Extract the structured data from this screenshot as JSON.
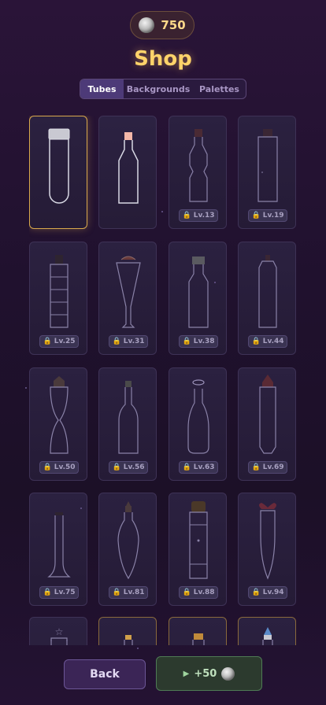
{
  "header": {
    "coin_balance": "750",
    "title": "Shop"
  },
  "tabs": [
    {
      "label": "Tubes",
      "active": true
    },
    {
      "label": "Backgrounds",
      "active": false
    },
    {
      "label": "Palettes",
      "active": false
    }
  ],
  "items": [
    {
      "shape": "test-tube",
      "state": "selected",
      "lock": ""
    },
    {
      "shape": "bottle-pink-cap",
      "state": "owned",
      "lock": ""
    },
    {
      "shape": "wavy-bottle",
      "state": "locked",
      "lock": "Lv.13"
    },
    {
      "shape": "tall-cylinder",
      "state": "locked",
      "lock": "Lv.19"
    },
    {
      "shape": "ladder-tube",
      "state": "locked",
      "lock": "Lv.25"
    },
    {
      "shape": "funnel-glass",
      "state": "locked",
      "lock": "Lv.31"
    },
    {
      "shape": "flask-cap",
      "state": "locked",
      "lock": "Lv.38"
    },
    {
      "shape": "rounded-jar",
      "state": "locked",
      "lock": "Lv.44"
    },
    {
      "shape": "hourglass",
      "state": "locked",
      "lock": "Lv.50"
    },
    {
      "shape": "wine-bottle",
      "state": "locked",
      "lock": "Lv.56"
    },
    {
      "shape": "halo-flask",
      "state": "locked",
      "lock": "Lv.63"
    },
    {
      "shape": "potion-house",
      "state": "locked",
      "lock": "Lv.69"
    },
    {
      "shape": "bell-column",
      "state": "locked",
      "lock": "Lv.75"
    },
    {
      "shape": "vase",
      "state": "locked",
      "lock": "Lv.81"
    },
    {
      "shape": "cork-column",
      "state": "locked",
      "lock": "Lv.88"
    },
    {
      "shape": "bow-teardrop",
      "state": "locked",
      "lock": "Lv.94"
    },
    {
      "shape": "star-top",
      "state": "partial",
      "lock": ""
    },
    {
      "shape": "gold-small",
      "state": "partial",
      "lock": ""
    },
    {
      "shape": "gold-jar",
      "state": "partial",
      "lock": ""
    },
    {
      "shape": "blue-drop",
      "state": "partial",
      "lock": ""
    }
  ],
  "footer": {
    "back_label": "Back",
    "ad_reward_label": "+50"
  },
  "icons": {
    "coin": "silver-coin-icon",
    "lock": "lock-icon",
    "play": "play-icon"
  },
  "colors": {
    "title": "#ffd36a",
    "coin_text": "#ffd98a",
    "selected_border": "#d9a94c",
    "active_tab": "#4d3a78"
  }
}
